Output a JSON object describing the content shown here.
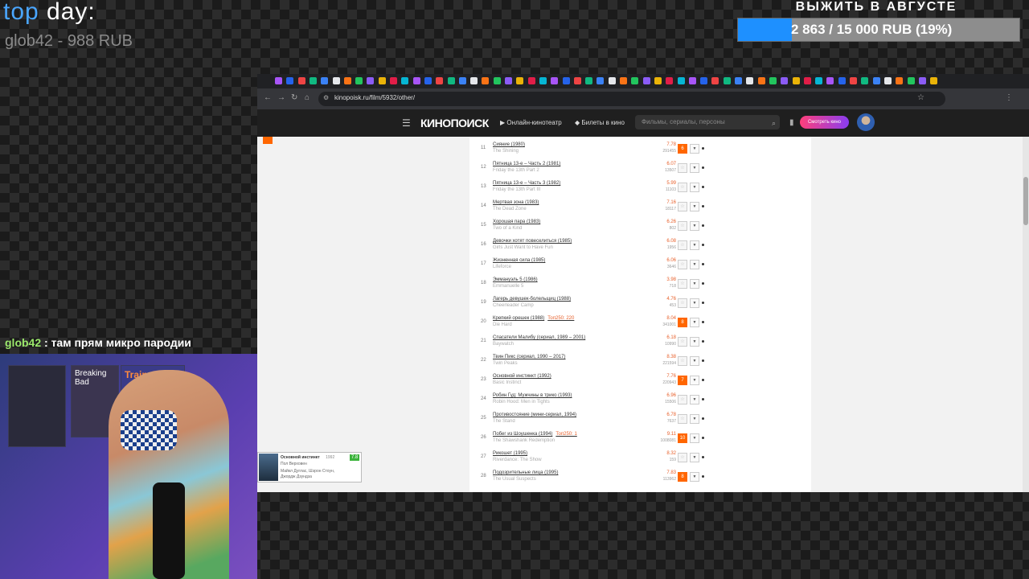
{
  "overlay": {
    "top_day_a": "top ",
    "top_day_b": "day:",
    "top_day_value": "glob42 - 988 RUB",
    "goal_title": "ВЫЖИТЬ В АВГУСТЕ",
    "goal_text": "2 863 / 15 000 RUB (19%)",
    "goal_fraction": 0.19,
    "chat_user": "glob42",
    "chat_message": ": там прям микро пародии",
    "poster_1": "Breaking Bad",
    "poster_2": "Trainspotting"
  },
  "browser": {
    "url": "kinopoisk.ru/film/5932/other/"
  },
  "kp": {
    "logo": "КИНОПОИСК",
    "online": "Онлайн-кинотеатр",
    "tickets": "Билеты в кино",
    "search_placeholder": "Фильмы, сериалы, персоны",
    "watch_button": "Смотреть кино"
  },
  "rows": [
    {
      "n": "11",
      "title": "Сияние (1980)",
      "orig": "The Shining",
      "rating": "7.78",
      "votes": "291455",
      "vote": "6",
      "top": ""
    },
    {
      "n": "12",
      "title": "Пятница 13-е – Часть 2 (1981)",
      "orig": "Friday the 13th Part 2",
      "rating": "6.07",
      "votes": "13507",
      "vote": "",
      "top": ""
    },
    {
      "n": "13",
      "title": "Пятница 13-е – Часть 3 (1982)",
      "orig": "Friday the 13th Part III",
      "rating": "5.99",
      "votes": "11103",
      "vote": "",
      "top": ""
    },
    {
      "n": "14",
      "title": "Мертвая зона (1983)",
      "orig": "The Dead Zone",
      "rating": "7.16",
      "votes": "18117",
      "vote": "",
      "top": ""
    },
    {
      "n": "15",
      "title": "Хорошая пара (1983)",
      "orig": "Two of a Kind",
      "rating": "6.26",
      "votes": "802",
      "vote": "",
      "top": ""
    },
    {
      "n": "16",
      "title": "Девочки хотят повеселиться (1985)",
      "orig": "Girls Just Want to Have Fun",
      "rating": "6.08",
      "votes": "1956",
      "vote": "",
      "top": ""
    },
    {
      "n": "17",
      "title": "Жизненная сила (1985)",
      "orig": "Lifeforce",
      "rating": "6.06",
      "votes": "3646",
      "vote": "",
      "top": ""
    },
    {
      "n": "18",
      "title": "Эммануэль 5 (1986)",
      "orig": "Emmanuelle 5",
      "rating": "3.98",
      "votes": "718",
      "vote": "",
      "top": ""
    },
    {
      "n": "19",
      "title": "Лагерь девушек-болельщиц (1988)",
      "orig": "Cheerleader Camp",
      "rating": "4.76",
      "votes": "453",
      "vote": "",
      "top": ""
    },
    {
      "n": "20",
      "title": "Крепкий орешек (1988)",
      "orig": "Die Hard",
      "rating": "8.04",
      "votes": "341001",
      "vote": "8",
      "top": "Топ250: 220"
    },
    {
      "n": "21",
      "title": "Спасатели Малибу (сериал, 1989 – 2001)",
      "orig": "Baywatch",
      "rating": "6.18",
      "votes": "10990",
      "vote": "",
      "top": ""
    },
    {
      "n": "22",
      "title": "Твин Пикс (сериал, 1990 – 2017)",
      "orig": "Twin Peaks",
      "rating": "8.38",
      "votes": "221594",
      "vote": "",
      "top": ""
    },
    {
      "n": "23",
      "title": "Основной инстинкт (1992)",
      "orig": "Basic Instinct",
      "rating": "7.76",
      "votes": "220943",
      "vote": "7",
      "top": ""
    },
    {
      "n": "24",
      "title": "Робин Гуд: Мужчины в трико (1993)",
      "orig": "Robin Hood: Men in Tights",
      "rating": "6.96",
      "votes": "15506",
      "vote": "",
      "top": ""
    },
    {
      "n": "25",
      "title": "Противостояние (мини-сериал, 1994)",
      "orig": "The Stand",
      "rating": "6.78",
      "votes": "7637",
      "vote": "",
      "top": ""
    },
    {
      "n": "26",
      "title": "Побег из Шоушенка (1994)",
      "orig": "The Shawshank Redemption",
      "rating": "9.11",
      "votes": "1008081",
      "vote": "10",
      "top": "Топ250: 1"
    },
    {
      "n": "27",
      "title": "Рикошет (1995)",
      "orig": "Riverdance: The Show",
      "rating": "8.32",
      "votes": "159",
      "vote": "",
      "top": ""
    },
    {
      "n": "28",
      "title": "Подозрительные лица (1995)",
      "orig": "The Usual Suspects",
      "rating": "7.83",
      "votes": "113962",
      "vote": "8",
      "top": ""
    }
  ],
  "popup": {
    "title": "Основной инстинкт",
    "year": "1992",
    "rating": "7.8",
    "director": "Пол Верховен",
    "cast": "Майкл Дуглас, Шэрон Стоун,",
    "cast2": "Джордж Дзундза"
  },
  "colors": {
    "accent": "#e8612c",
    "goal": "#1e90ff",
    "chat_user": "#9be86b"
  }
}
